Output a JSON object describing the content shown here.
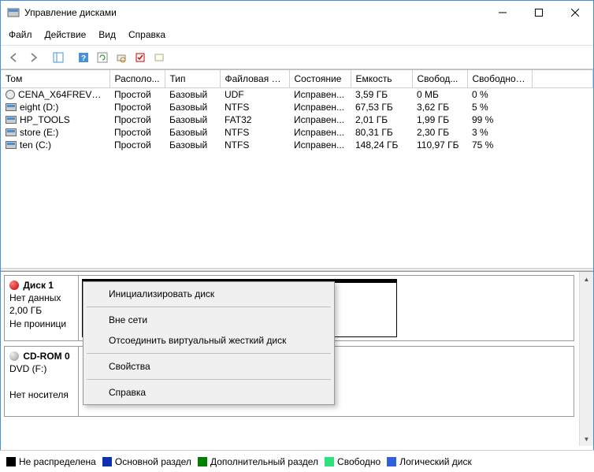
{
  "window": {
    "title": "Управление дисками"
  },
  "menu": {
    "file": "Файл",
    "action": "Действие",
    "view": "Вид",
    "help": "Справка"
  },
  "columns": {
    "volume": "Том",
    "layout": "Располо...",
    "type": "Тип",
    "filesystem": "Файловая с...",
    "status": "Состояние",
    "capacity": "Емкость",
    "free": "Свобод...",
    "freepct": "Свободно %"
  },
  "volumes": [
    {
      "name": "CENA_X64FREV_R...",
      "layout": "Простой",
      "type": "Базовый",
      "fs": "UDF",
      "status": "Исправен...",
      "capacity": "3,59 ГБ",
      "free": "0 МБ",
      "freepct": "0 %",
      "icon": "cd"
    },
    {
      "name": "eight (D:)",
      "layout": "Простой",
      "type": "Базовый",
      "fs": "NTFS",
      "status": "Исправен...",
      "capacity": "67,53 ГБ",
      "free": "3,62 ГБ",
      "freepct": "5 %",
      "icon": "hdd"
    },
    {
      "name": "HP_TOOLS",
      "layout": "Простой",
      "type": "Базовый",
      "fs": "FAT32",
      "status": "Исправен...",
      "capacity": "2,01 ГБ",
      "free": "1,99 ГБ",
      "freepct": "99 %",
      "icon": "hdd"
    },
    {
      "name": "store (E:)",
      "layout": "Простой",
      "type": "Базовый",
      "fs": "NTFS",
      "status": "Исправен...",
      "capacity": "80,31 ГБ",
      "free": "2,30 ГБ",
      "freepct": "3 %",
      "icon": "hdd"
    },
    {
      "name": "ten (C:)",
      "layout": "Простой",
      "type": "Базовый",
      "fs": "NTFS",
      "status": "Исправен...",
      "capacity": "148,24 ГБ",
      "free": "110,97 ГБ",
      "freepct": "75 %",
      "icon": "hdd"
    }
  ],
  "disks": {
    "disk1": {
      "title": "Диск 1",
      "line1": "Нет данных",
      "line2": "2,00 ГБ",
      "line3": "Не проиници"
    },
    "cdrom0": {
      "title": "CD-ROM 0",
      "line1": "DVD (F:)",
      "line2": "",
      "status": "Нет носителя"
    }
  },
  "context_menu": {
    "initialize": "Инициализировать диск",
    "offline": "Вне сети",
    "detach_vhd": "Отсоединить виртуальный жесткий диск",
    "properties": "Свойства",
    "help": "Справка"
  },
  "legend": {
    "unallocated": "Не распределена",
    "primary": "Основной раздел",
    "extended": "Дополнительный раздел",
    "free": "Свободно",
    "logical": "Логический диск"
  },
  "legend_colors": {
    "unallocated": "#000000",
    "primary": "#1030b0",
    "extended": "#008000",
    "free": "#30e080",
    "logical": "#3060e0"
  }
}
